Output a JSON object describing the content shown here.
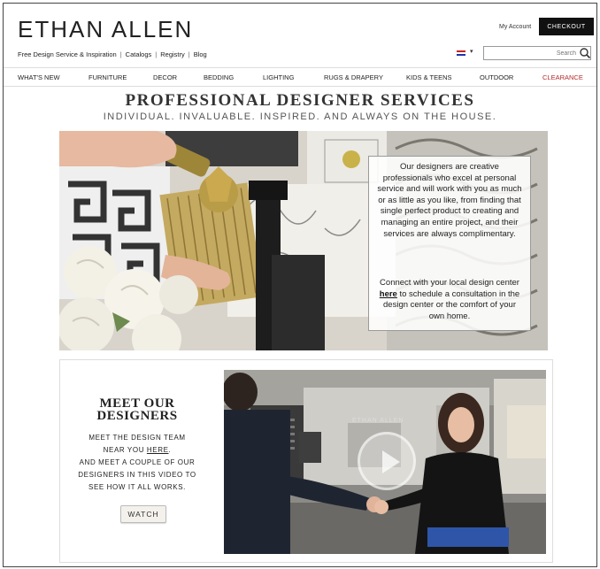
{
  "header": {
    "logo": "ETHAN ALLEN",
    "my_account": "My Account",
    "checkout": "CHECKOUT",
    "utility_links": [
      "Free Design Service & Inspiration",
      "Catalogs",
      "Registry",
      "Blog"
    ],
    "search_placeholder": "Search"
  },
  "nav": [
    "WHAT'S NEW",
    "FURNITURE",
    "DECOR",
    "BEDDING",
    "LIGHTING",
    "RUGS & DRAPERY",
    "KIDS & TEENS",
    "OUTDOOR",
    "CLEARANCE"
  ],
  "hero": {
    "title": "PROFESSIONAL DESIGNER SERVICES",
    "subtitle": "INDIVIDUAL. INVALUABLE. INSPIRED. AND ALWAYS ON THE HOUSE.",
    "paragraph1": "Our designers are creative professionals who excel at personal service and will work with you as much or as little as you like, from finding that single perfect product to creating and managing an entire project, and their services are always complimentary.",
    "paragraph2_before": "Connect with your local design center ",
    "paragraph2_link": "here",
    "paragraph2_after": " to schedule a consultation in the design center or the comfort of your own home."
  },
  "designers": {
    "heading_line1": "MEET OUR",
    "heading_line2": "DESIGNERS",
    "desc_line1": "MEET THE DESIGN TEAM",
    "desc_line2_before": "NEAR YOU ",
    "desc_line2_link": "HERE",
    "desc_line2_after": ".",
    "desc_line3": "AND MEET A COUPLE OF OUR",
    "desc_line4": "DESIGNERS IN THIS VIDEO TO",
    "desc_line5": "SEE HOW IT ALL WORKS.",
    "watch": "WATCH",
    "video_sign": "ETHAN ALLEN"
  },
  "colors": {
    "clearance": "#b52a2a",
    "checkout_bg": "#111111"
  }
}
